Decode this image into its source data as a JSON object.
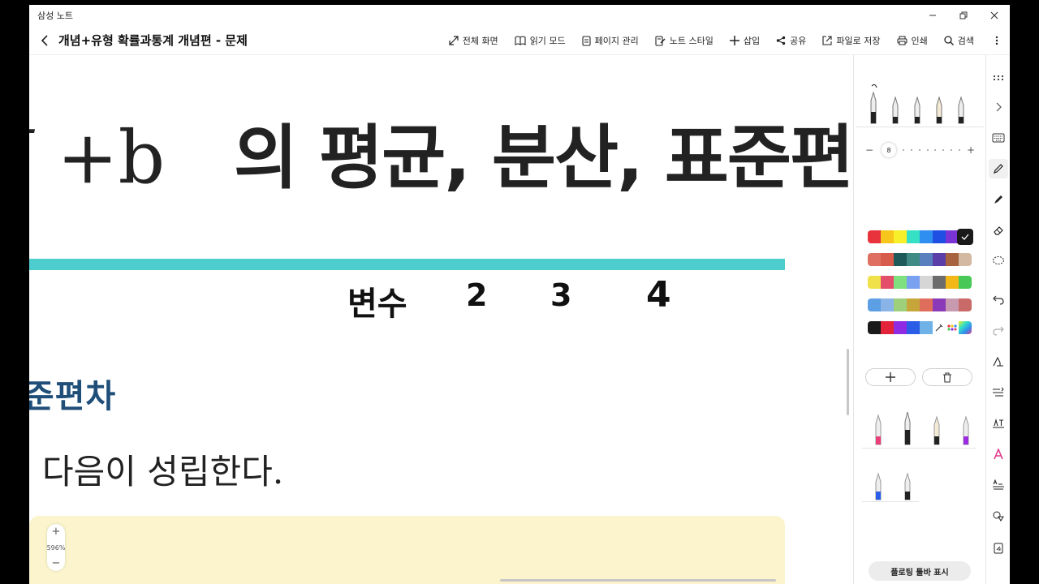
{
  "window": {
    "app_name": "삼성 노트",
    "controls": [
      "minimize-icon",
      "restore-icon",
      "close-icon"
    ]
  },
  "toolbar": {
    "title": "개념+유형 확률과통계 개념편 - 문제",
    "actions": [
      {
        "label": "전체 화면",
        "icon": "fullscreen-icon"
      },
      {
        "label": "읽기 모드",
        "icon": "book-icon"
      },
      {
        "label": "페이지 관리",
        "icon": "page-icon"
      },
      {
        "label": "노트 스타일",
        "icon": "style-icon"
      },
      {
        "label": "삽입",
        "icon": "plus-icon"
      },
      {
        "label": "공유",
        "icon": "share-icon"
      },
      {
        "label": "파일로 저장",
        "icon": "save-file-icon"
      },
      {
        "label": "인쇄",
        "icon": "print-icon"
      },
      {
        "label": "검색",
        "icon": "search-icon"
      }
    ]
  },
  "canvas": {
    "heading_math": "+b",
    "heading_math_prefix": "I",
    "heading_text": "의 평균, 분산, 표준편차",
    "handwriting": [
      "변수",
      "2",
      "3",
      "4"
    ],
    "section_title": "표준편차",
    "body_text": "다음이 성립한다.",
    "zoom": "596%",
    "zoom_in": "+",
    "zoom_out": "−"
  },
  "pen_panel": {
    "pen_size": "8",
    "palette_rows": [
      [
        "#e8323c",
        "#f7c61c",
        "#f7ef2a",
        "#35e0c4",
        "#2f8ff0",
        "#1f4fe3",
        "#7a34d6",
        "#222222"
      ],
      [
        "#de6f61",
        "#d85c4c",
        "#1f5a5a",
        "#3f8a84",
        "#5a7fbf",
        "#5b3ea8",
        "#a76240",
        "#d3b9a2"
      ],
      [
        "#f0e04a",
        "#e34f6a",
        "#7ee07f",
        "#7aa0f0",
        "#d6d6d6",
        "#6c6c6c",
        "#f2b818",
        "#48c957"
      ],
      [
        "#5d9fe4",
        "#8ab4e8",
        "#9ed07c",
        "#c6a53a",
        "#df6d5c",
        "#8a3ab8",
        "#c89ab0",
        "#c96a68"
      ],
      [
        "#1a1a1a",
        "#e3233a",
        "#8f2be2",
        "#2b5de6",
        "#6fb2e8",
        "#eyedropper",
        "#multicolor",
        "#gradient"
      ]
    ],
    "add_label": "+",
    "floating_toolbar_label": "플로팅 툴바 표시"
  },
  "tool_strip": {
    "items": [
      "grip-icon",
      "chevron-right-icon",
      "keyboard-icon",
      "pen-icon",
      "highlighter-icon",
      "eraser-icon",
      "lasso-icon",
      "undo-icon",
      "redo-icon",
      "shape-icon",
      "text-align-icon",
      "handwriting-convert-icon",
      "text-color-icon",
      "straighten-icon",
      "shapes-icon",
      "attach-icon"
    ]
  }
}
